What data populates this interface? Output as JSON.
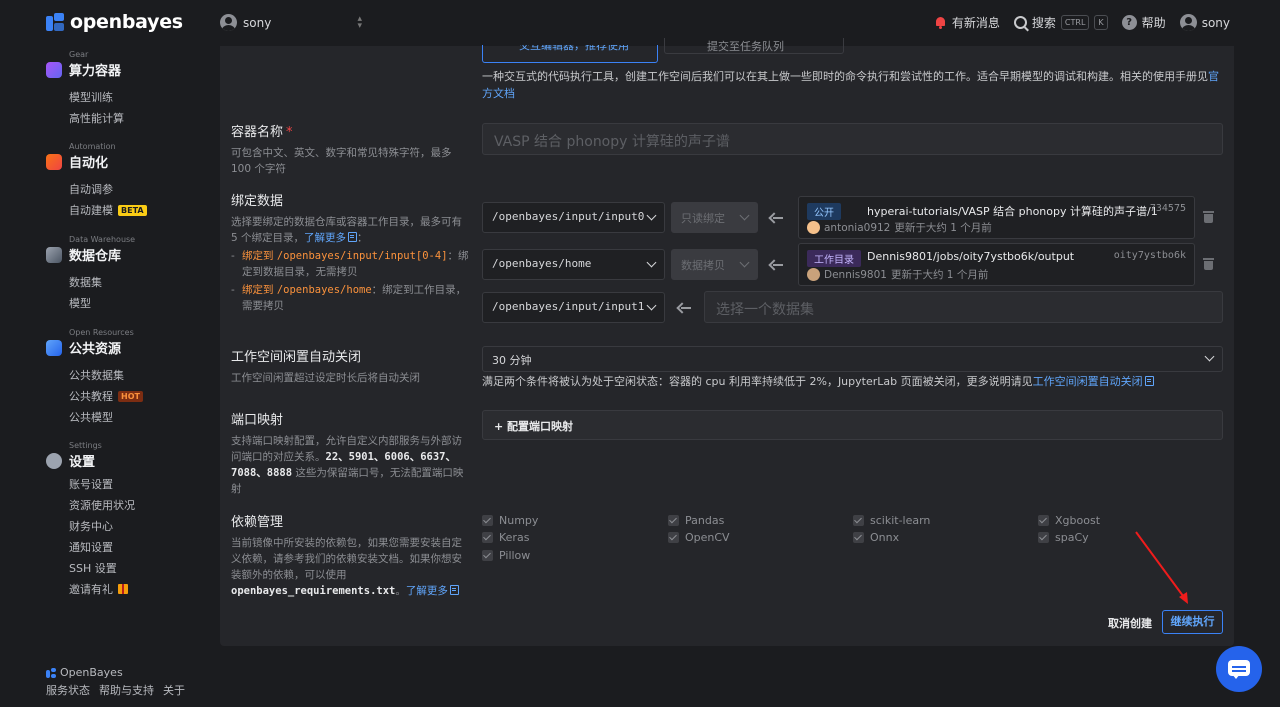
{
  "brand": {
    "name": "openbayes",
    "footer_name": "OpenBayes"
  },
  "workspace": {
    "name": "sony"
  },
  "top": {
    "notify": "有新消息",
    "search": "搜索",
    "kbd_ctrl": "CTRL",
    "kbd_k": "K",
    "help": "帮助",
    "user": "sony"
  },
  "sidebar": {
    "gear": {
      "caption": "Gear",
      "title": "算力容器",
      "items": [
        "模型训练",
        "高性能计算"
      ]
    },
    "automation": {
      "caption": "Automation",
      "title": "自动化",
      "items": [
        "自动调参",
        "自动建模"
      ],
      "badge": "BETA"
    },
    "warehouse": {
      "caption": "Data Warehouse",
      "title": "数据仓库",
      "items": [
        "数据集",
        "模型"
      ]
    },
    "open": {
      "caption": "Open Resources",
      "title": "公共资源",
      "items": [
        "公共数据集",
        "公共教程",
        "公共模型"
      ],
      "badge": "HOT"
    },
    "settings": {
      "caption": "Settings",
      "title": "设置",
      "items": [
        "账号设置",
        "资源使用状况",
        "财务中心",
        "通知设置",
        "SSH 设置",
        "邀请有礼"
      ]
    }
  },
  "footer": {
    "links": [
      "服务状态",
      "帮助与支持",
      "关于"
    ]
  },
  "form": {
    "tab_active": "交互编辑器，推荐使用",
    "tab_other": "提交至任务队列",
    "intro": "一种交互式的代码执行工具，创建工作空间后我们可以在其上做一些即时的命令执行和尝试性的工作。适合早期模型的调试和构建。相关的使用手册见",
    "intro_link": "官方文档",
    "name": {
      "label": "容器名称",
      "required": "*",
      "desc": "可包含中文、英文、数字和常见特殊字符，最多 100 个字符",
      "placeholder": "VASP 结合 phonopy 计算硅的声子谱"
    },
    "bind": {
      "label": "绑定数据",
      "desc": "选择要绑定的数据仓库或容器工作目录，最多可有 5 个绑定目录，",
      "more": "了解更多",
      "bullet1_prefix": "绑定到",
      "bullet1_path": "/openbayes/input/input[0-4]",
      "bullet1_suffix": "：绑定到数据目录，无需拷贝",
      "bullet2_prefix": "绑定到",
      "bullet2_path": "/openbayes/home",
      "bullet2_suffix": "：绑定到工作目录，需要拷贝",
      "rows": [
        {
          "target": "/openbayes/input/input0",
          "mode": "只读绑定",
          "tag": "公开",
          "path": "hyperai-tutorials/VASP 结合 phonopy 计算硅的声子谱/1",
          "id": "734575",
          "owner": "antonia0912",
          "updated": "更新于大约 1 个月前"
        },
        {
          "target": "/openbayes/home",
          "mode": "数据拷贝",
          "tag": "工作目录",
          "path": "Dennis9801/jobs/oity7ystbo6k/output",
          "id": "oity7ystbo6k",
          "owner": "Dennis9801",
          "updated": "更新于大约 1 个月前"
        },
        {
          "target": "/openbayes/input/input1",
          "placeholder": "选择一个数据集"
        }
      ]
    },
    "idle": {
      "label": "工作空间闲置自动关闭",
      "desc": "工作空间闲置超过设定时长后将自动关闭",
      "value": "30 分钟",
      "note": "满足两个条件将被认为处于空闲状态：容器的 cpu 利用率持续低于 2%，JupyterLab 页面被关闭，更多说明请见",
      "note_link": "工作空间闲置自动关闭"
    },
    "port": {
      "label": "端口映射",
      "desc_a": "支持端口映射配置，允许自定义内部服务与外部访问端口的对应关系。",
      "ports": "22、5901、6006、6637、7088、8888",
      "desc_b": " 这些为保留端口号，无法配置端口映射",
      "button": "+ 配置端口映射"
    },
    "deps": {
      "label": "依赖管理",
      "desc": "当前镜像中所安装的依赖包，如果您需要安装自定义依赖，请参考我们的依赖安装文档。如果你想安装额外的依赖，可以使用",
      "file": "openbayes_requirements.txt",
      "more": "了解更多",
      "items": [
        "Numpy",
        "Pandas",
        "scikit-learn",
        "Xgboost",
        "Keras",
        "OpenCV",
        "Onnx",
        "spaCy",
        "Pillow"
      ]
    },
    "cancel": "取消创建",
    "continue": "继续执行"
  },
  "colors": {
    "accent": "#3b82f6",
    "danger": "#ef4444",
    "warn": "#fb923c"
  }
}
